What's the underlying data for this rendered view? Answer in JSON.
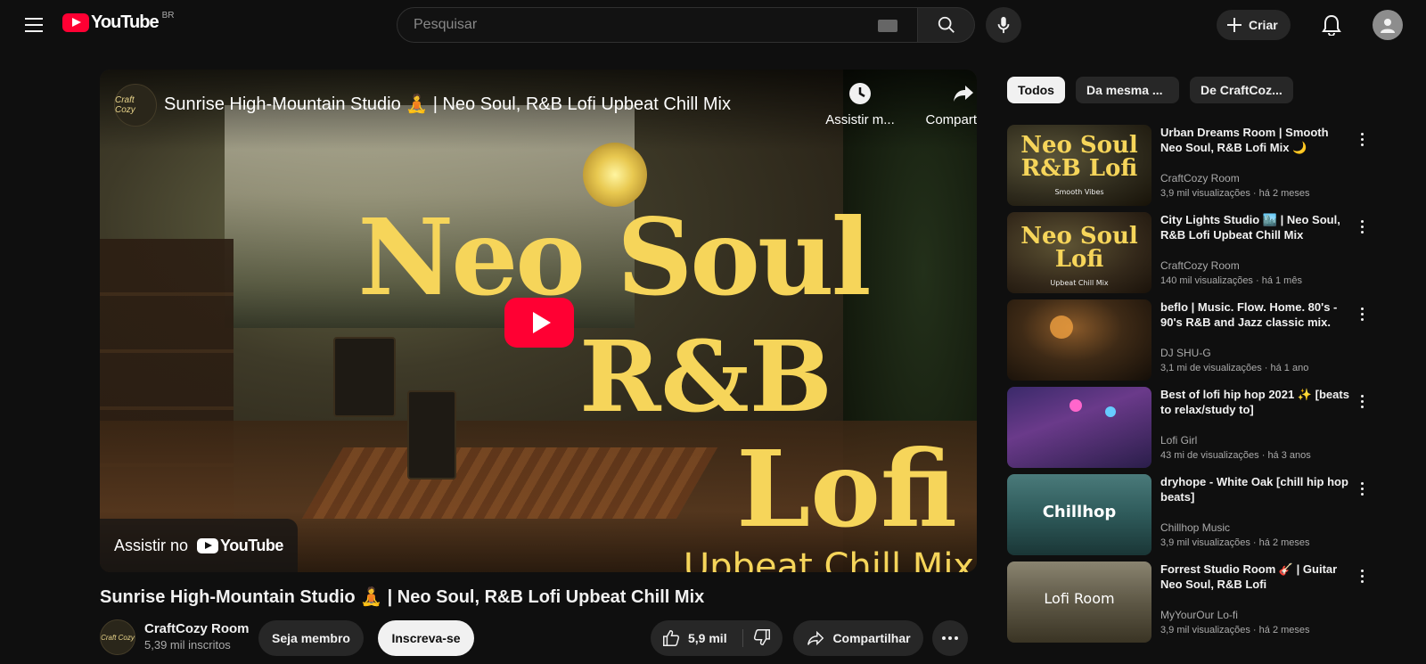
{
  "header": {
    "logo_text": "YouTube",
    "country": "BR",
    "search_placeholder": "Pesquisar",
    "create_label": "Criar",
    "icons": [
      "menu-icon",
      "keyboard-icon",
      "search-icon",
      "mic-icon",
      "plus-icon",
      "bell-icon",
      "account-icon"
    ]
  },
  "player": {
    "overlay_title": "Sunrise High-Mountain Studio 🧘 | Neo Soul, R&B Lofi Upbeat Chill Mix",
    "watch_later_label": "Assistir m...",
    "share_label": "Compartilh...",
    "watch_on_label": "Assistir no",
    "watch_on_brand": "YouTube",
    "channel_logo_text": "Craft Cozy",
    "thumbnail_text": {
      "line1": "Neo Soul",
      "line2": "R&B",
      "line3": "Lofi",
      "line4": "Upbeat Chill Mix"
    },
    "brand_color": "#ff0033",
    "accent_text_color": "#f6d55a"
  },
  "video": {
    "title": "Sunrise High-Mountain Studio 🧘 | Neo Soul, R&B Lofi Upbeat Chill Mix",
    "channel_name": "CraftCozy Room",
    "subscribers": "5,39 mil inscritos",
    "join_label": "Seja membro",
    "subscribe_label": "Inscreva-se",
    "likes": "5,9 mil",
    "share_label": "Compartilhar"
  },
  "sidebar": {
    "chips": [
      "Todos",
      "Da mesma ...",
      "De CraftCoz..."
    ],
    "recommendations": [
      {
        "title": "Urban Dreams Room | Smooth Neo Soul, R&B Lofi Mix 🌙",
        "channel": "CraftCozy Room",
        "meta": "3,9 mil visualizações · há 2 meses",
        "thumb_text": "Neo Soul R&B Lofi",
        "thumb_sub": "Smooth Vibes"
      },
      {
        "title": "City Lights Studio 🏙️ | Neo Soul, R&B Lofi Upbeat Chill Mix",
        "channel": "CraftCozy Room",
        "meta": "140 mil visualizações · há 1 mês",
        "thumb_text": "Neo Soul Lofi",
        "thumb_sub": "Upbeat Chill Mix"
      },
      {
        "title": "beflo | Music. Flow. Home. 80's - 90's R&B and Jazz classic mix.",
        "channel": "DJ SHU-G",
        "meta": "3,1 mi de visualizações · há 1 ano",
        "thumb_text": "",
        "thumb_sub": ""
      },
      {
        "title": "Best of lofi hip hop 2021 ✨ [beats to relax/study to]",
        "channel": "Lofi Girl",
        "meta": "43 mi de visualizações · há 3 anos",
        "thumb_text": "",
        "thumb_sub": ""
      },
      {
        "title": "dryhope - White Oak [chill hip hop beats]",
        "channel": "Chillhop Music",
        "meta": "3,9 mil visualizações · há 2 meses",
        "thumb_text": "Chillhop",
        "thumb_sub": ""
      },
      {
        "title": "Forrest Studio Room 🎸 | Guitar Neo Soul, R&B Lofi",
        "channel": "MyYourOur Lo-fi",
        "meta": "3,9 mil visualizações · há 2 meses",
        "thumb_text": "Lofi Room",
        "thumb_sub": ""
      }
    ]
  }
}
